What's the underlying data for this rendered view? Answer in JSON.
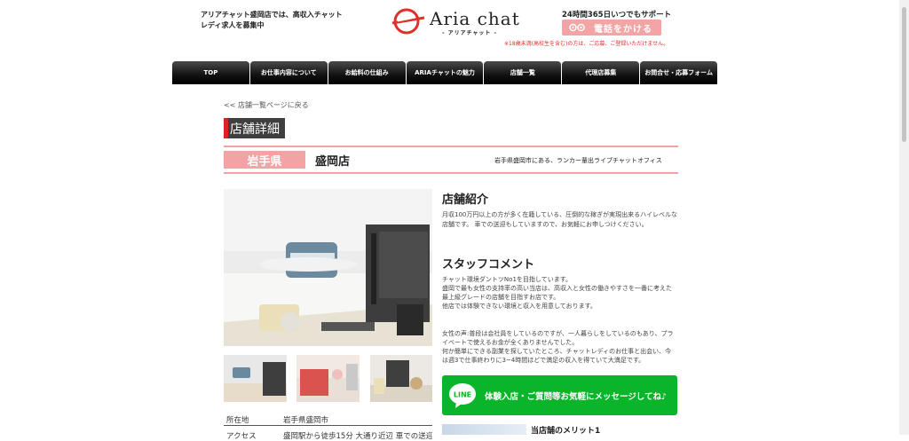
{
  "header": {
    "tagline": "アリアチャット盛岡店では、高収入チャットレディ求人を募集中",
    "logo_text": "Aria chat",
    "logo_sub": "- アリアチャット -",
    "support_text": "24時間365日いつでもサポート",
    "call_label": "電話をかける",
    "warning": "※18歳未満(高校生を含む)の方は、ご応募、ご登録いただけません。"
  },
  "nav": {
    "items": [
      {
        "label": "TOP"
      },
      {
        "label": "お仕事内容について"
      },
      {
        "label": "お給料の仕組み"
      },
      {
        "label": "ARIAチャットの魅力"
      },
      {
        "label": "店舗一覧"
      },
      {
        "label": "代理店募集"
      },
      {
        "label": "お問合せ・応募フォーム"
      }
    ]
  },
  "breadcrumb": {
    "back_label": "<< 店舗一覧ページに戻る"
  },
  "page": {
    "title": "店舗詳細",
    "prefecture": "岩手県",
    "shop_name": "盛岡店",
    "shop_desc": "岩手県盛岡市にある、ランカー輩出ライブチャットオフィス"
  },
  "info": {
    "rows": [
      {
        "label": "所在地",
        "value": "岩手県盛岡市"
      },
      {
        "label": "アクセス",
        "value": "盛岡駅から徒歩15分 大通り近辺 車での送迎"
      }
    ]
  },
  "intro": {
    "heading": "店舗紹介",
    "body": "月収100万円以上の方が多く在籍している、圧倒的な稼ぎが実現出来るハイレベルな店舗です。 車での送迎もしていますので、お気軽にお申しつけください。"
  },
  "staff": {
    "heading": "スタッフコメント",
    "lines": [
      "チャット環境ダントツNo1を目指しています。",
      "盛岡で最も女性の支持率の高い当店は、高収入と女性の働きやすさを一番に考えた最上級グレードの店舗を目指すお店です。",
      "他店では体験できない環境と収入を用意しております。"
    ],
    "voice": [
      "女性の声:普段は会社員をしているのですが、一人暮らしをしているのもあり、プライベートで使えるお金が全くありませんでした。",
      "何か簡単にできる副業を探していたところ、チャットレディのお仕事と出会い、今は週3で仕事終わりに3~4時間ほどで満足の収入を得ていて大満足です。"
    ]
  },
  "line_cta": {
    "icon_text": "LINE",
    "label": "体験入店・ご質問等お気軽にメッセージしてね♪"
  },
  "merit": {
    "heading": "当店舗のメリット1"
  }
}
